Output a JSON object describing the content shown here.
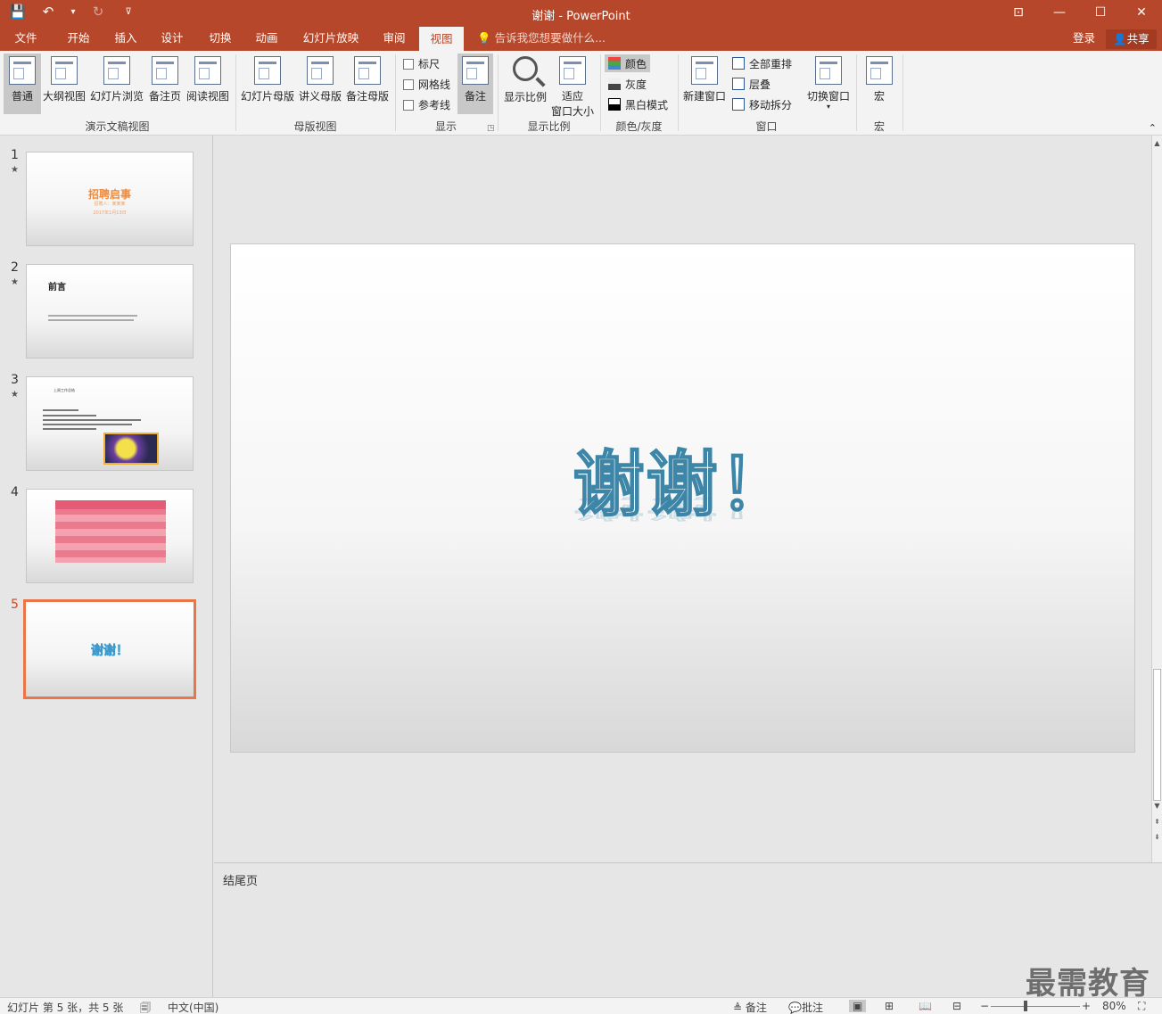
{
  "app": {
    "window_title": "谢谢 - PowerPoint",
    "window_controls": {
      "ribbon_opts": "⊡",
      "minimize": "—",
      "maximize": "☐",
      "close": "✕"
    }
  },
  "qat": {
    "save": "💾",
    "undo": "↶",
    "undo_dd": "▾",
    "redo": "↻",
    "customize": "⊽"
  },
  "tabs": [
    {
      "label": "文件"
    },
    {
      "label": "开始"
    },
    {
      "label": "插入"
    },
    {
      "label": "设计"
    },
    {
      "label": "切换"
    },
    {
      "label": "动画"
    },
    {
      "label": "幻灯片放映"
    },
    {
      "label": "审阅"
    },
    {
      "label": "视图",
      "active": true
    }
  ],
  "tell_me": "告诉我您想要做什么...",
  "account": {
    "login": "登录",
    "share": "共享"
  },
  "ribbon": {
    "presentation_views": {
      "label": "演示文稿视图",
      "buttons": [
        "普通",
        "大纲视图",
        "幻灯片浏览",
        "备注页",
        "阅读视图"
      ]
    },
    "master_views": {
      "label": "母版视图",
      "buttons": [
        "幻灯片母版",
        "讲义母版",
        "备注母版"
      ]
    },
    "show": {
      "label": "显示",
      "checks": [
        "标尺",
        "网格线",
        "参考线"
      ],
      "notes": "备注"
    },
    "zoom": {
      "label": "显示比例",
      "zoom_btn": "显示比例",
      "fit_line1": "适应",
      "fit_line2": "窗口大小"
    },
    "color": {
      "label": "颜色/灰度",
      "items": [
        "颜色",
        "灰度",
        "黑白模式"
      ]
    },
    "window": {
      "label": "窗口",
      "new_window": "新建窗口",
      "items": [
        "全部重排",
        "层叠",
        "移动拆分"
      ],
      "switch": "切换窗口"
    },
    "macros": {
      "label": "宏",
      "button": "宏"
    }
  },
  "slides": [
    {
      "num": "1",
      "star": "★",
      "title": "招聘启事",
      "sub": "招聘人：某某某",
      "date": "2017年1月13日"
    },
    {
      "num": "2",
      "star": "★",
      "title": "前言"
    },
    {
      "num": "3",
      "star": "★",
      "title": "上周工作总结"
    },
    {
      "num": "4",
      "star": ""
    },
    {
      "num": "5",
      "star": "",
      "title": "谢谢！",
      "current": true
    }
  ],
  "current_slide": {
    "text": "谢谢！"
  },
  "notes_text": "结尾页",
  "watermark": "最需教育",
  "status": {
    "slide_info": "幻灯片 第 5 张，共 5 张",
    "language": "中文(中国)",
    "notes": "备注",
    "comments": "批注",
    "zoom": "80%"
  },
  "colors": {
    "accent": "#b7472a",
    "current_thumb": "#e97548"
  }
}
